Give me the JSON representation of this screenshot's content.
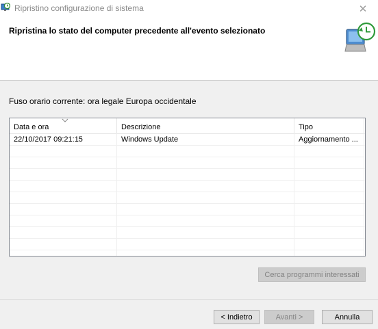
{
  "window": {
    "title": "Ripristino configurazione di sistema",
    "close_glyph": "✕"
  },
  "header": {
    "heading": "Ripristina lo stato del computer precedente all'evento selezionato",
    "icon": "system-restore-icon"
  },
  "timezone": {
    "label": "Fuso orario corrente: ora legale Europa occidentale"
  },
  "restore_points": {
    "columns": [
      "Data e ora",
      "Descrizione",
      "Tipo"
    ],
    "sorted_column": "Data e ora",
    "rows": [
      {
        "date": "22/10/2017 09:21:15",
        "description": "Windows Update",
        "type": "Aggiornamento ..."
      }
    ]
  },
  "buttons": {
    "scan": "Cerca programmi interessati",
    "back": "< Indietro",
    "next": "Avanti >",
    "cancel": "Annulla"
  },
  "colors": {
    "dialog_bg": "#f0f0f0",
    "header_bg": "#ffffff",
    "disabled_text": "#838383"
  }
}
